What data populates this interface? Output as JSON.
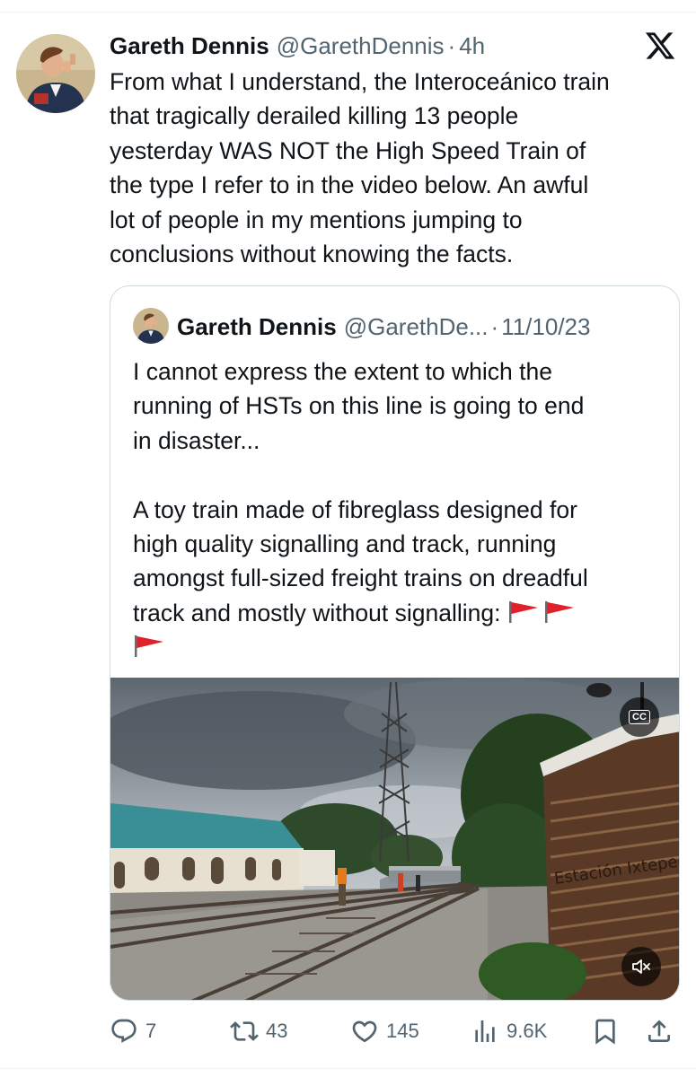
{
  "tweet": {
    "author_name": "Gareth Dennis",
    "author_handle": "@GarethDennis",
    "separator": "·",
    "time": "4h",
    "text": "From what I understand, the Interoceánico train\nthat tragically derailed killing 13 people\nyesterday WAS NOT the High Speed Train of\nthe type I refer to in the video below. An awful\nlot of people in my mentions jumping to\nconclusions without knowing the facts."
  },
  "quoted_tweet": {
    "author_name": "Gareth Dennis",
    "author_handle": "@GarethDe...",
    "separator": "·",
    "date": "11/10/23",
    "text": "I cannot express the extent to which the\nrunning of HSTs on this line is going to end\nin disaster...\n\nA toy train made of fibreglass designed for\nhigh quality signalling and track, running\namongst full-sized freight trains on dreadful\ntrack and mostly without signalling: ",
    "flags": [
      "triangular-flag-icon",
      "triangular-flag-icon",
      "triangular-flag-icon"
    ],
    "video": {
      "cc_label": "CC",
      "station_sign_text": "Estación Ixtepec"
    }
  },
  "actions": {
    "replies": "7",
    "reposts": "43",
    "likes": "145",
    "views": "9.6K"
  },
  "colors": {
    "text_primary": "#0f1419",
    "text_secondary": "#536471",
    "border": "#cfd9de",
    "flag_red": "#e0202a"
  }
}
